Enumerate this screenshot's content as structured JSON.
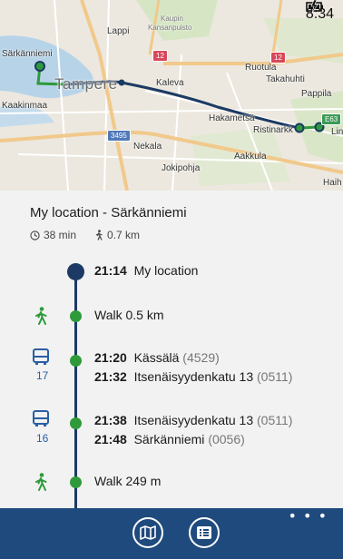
{
  "status": {
    "time": "8:34",
    "battery_icon": "battery-charging-icon"
  },
  "map": {
    "labels": {
      "kaupin": "Kaupin",
      "kansanpuisto": "Kansanpuisto",
      "lappi": "Lappi",
      "sarkanniemi": "Särkänniemi",
      "tampere": "Tampere",
      "kaleva": "Kaleva",
      "ruotula": "Ruotula",
      "takahuhti": "Takahuhti",
      "pappila": "Pappila",
      "kaakinmaa": "Kaakinmaa",
      "hakametsa": "Hakametsä",
      "ristinarkku": "Ristinarkk",
      "lin": "Lin",
      "nekala": "Nekala",
      "aakkula": "Aakkula",
      "jokipohja": "Jokipohja",
      "haih": "Haih"
    },
    "badges": {
      "road12a": "12",
      "road12b": "12",
      "road3495": "3495",
      "roadE63": "E63"
    }
  },
  "route": {
    "title": "My location  - Särkänniemi",
    "duration": "38 min",
    "distance": "0.7 km"
  },
  "steps": [
    {
      "time": "21:14",
      "text": "My location"
    },
    {
      "time": "",
      "text": "Walk  0.5 km"
    },
    {
      "time": "21:20",
      "text": "Kässälä",
      "code": "(4529)"
    },
    {
      "time": "21:32",
      "text": "Itsenäisyydenkatu 13",
      "code": "(0511)"
    },
    {
      "time": "21:38",
      "text": "Itsenäisyydenkatu 13",
      "code": "(0511)"
    },
    {
      "time": "21:48",
      "text": "Särkänniemi",
      "code": "(0056)"
    },
    {
      "time": "",
      "text": "Walk  249 m"
    }
  ],
  "lines": {
    "first": "17",
    "second": "16"
  },
  "appbar": {
    "map_button_icon": "map-icon",
    "list_button_icon": "list-icon",
    "more": "• • •"
  },
  "colors": {
    "route_line": "#1c3a63",
    "walk_green": "#2e9a3a",
    "appbar": "#1f4a7d",
    "bus_blue": "#2a5ea4"
  }
}
